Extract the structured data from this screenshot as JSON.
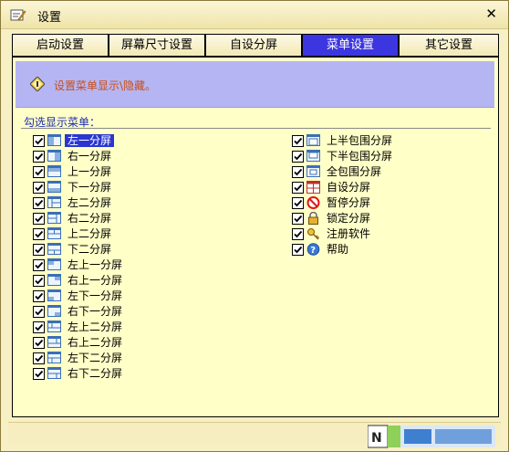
{
  "window": {
    "title": "设置",
    "close_glyph": "✕"
  },
  "tabs": [
    {
      "label": "启动设置",
      "active": false
    },
    {
      "label": "屏幕尺寸设置",
      "active": false
    },
    {
      "label": "自设分屏",
      "active": false
    },
    {
      "label": "菜单设置",
      "active": true
    },
    {
      "label": "其它设置",
      "active": false
    }
  ],
  "banner": {
    "text": "设置菜单显示\\隐藏。",
    "icon": "diamond-info-icon"
  },
  "section": {
    "label": "勾选显示菜单："
  },
  "left_items": [
    {
      "label": "左一分屏",
      "checked": true,
      "selected": true,
      "icon": "layout-left-one-icon"
    },
    {
      "label": "右一分屏",
      "checked": true,
      "icon": "layout-right-one-icon"
    },
    {
      "label": "上一分屏",
      "checked": true,
      "icon": "layout-top-one-icon"
    },
    {
      "label": "下一分屏",
      "checked": true,
      "icon": "layout-bottom-one-icon"
    },
    {
      "label": "左二分屏",
      "checked": true,
      "icon": "layout-left-two-icon"
    },
    {
      "label": "右二分屏",
      "checked": true,
      "icon": "layout-right-two-icon"
    },
    {
      "label": "上二分屏",
      "checked": true,
      "icon": "layout-top-two-icon"
    },
    {
      "label": "下二分屏",
      "checked": true,
      "icon": "layout-bottom-two-icon"
    },
    {
      "label": "左上一分屏",
      "checked": true,
      "icon": "layout-top-left-one-icon"
    },
    {
      "label": "右上一分屏",
      "checked": true,
      "icon": "layout-top-right-one-icon"
    },
    {
      "label": "左下一分屏",
      "checked": true,
      "icon": "layout-bottom-left-one-icon"
    },
    {
      "label": "右下一分屏",
      "checked": true,
      "icon": "layout-bottom-right-one-icon"
    },
    {
      "label": "左上二分屏",
      "checked": true,
      "icon": "layout-top-left-two-icon"
    },
    {
      "label": "右上二分屏",
      "checked": true,
      "icon": "layout-top-right-two-icon"
    },
    {
      "label": "左下二分屏",
      "checked": true,
      "icon": "layout-bottom-left-two-icon"
    },
    {
      "label": "右下二分屏",
      "checked": true,
      "icon": "layout-bottom-right-two-icon"
    }
  ],
  "right_items": [
    {
      "label": "上半包围分屏",
      "checked": true,
      "icon": "layout-top-half-surround-icon"
    },
    {
      "label": "下半包围分屏",
      "checked": true,
      "icon": "layout-bottom-half-surround-icon"
    },
    {
      "label": "全包围分屏",
      "checked": true,
      "icon": "layout-full-surround-icon"
    },
    {
      "label": "自设分屏",
      "checked": true,
      "icon": "custom-layout-icon"
    },
    {
      "label": "暂停分屏",
      "checked": true,
      "icon": "pause-icon"
    },
    {
      "label": "锁定分屏",
      "checked": true,
      "icon": "lock-icon"
    },
    {
      "label": "注册软件",
      "checked": true,
      "icon": "key-icon"
    },
    {
      "label": "帮助",
      "checked": true,
      "icon": "help-icon"
    }
  ],
  "colors": {
    "active_tab": "#3c36e0",
    "panel_bg": "#ffffc8",
    "banner_bg": "#b6b5f4",
    "banner_text": "#c84f16",
    "section_text": "#1b2bb0"
  }
}
